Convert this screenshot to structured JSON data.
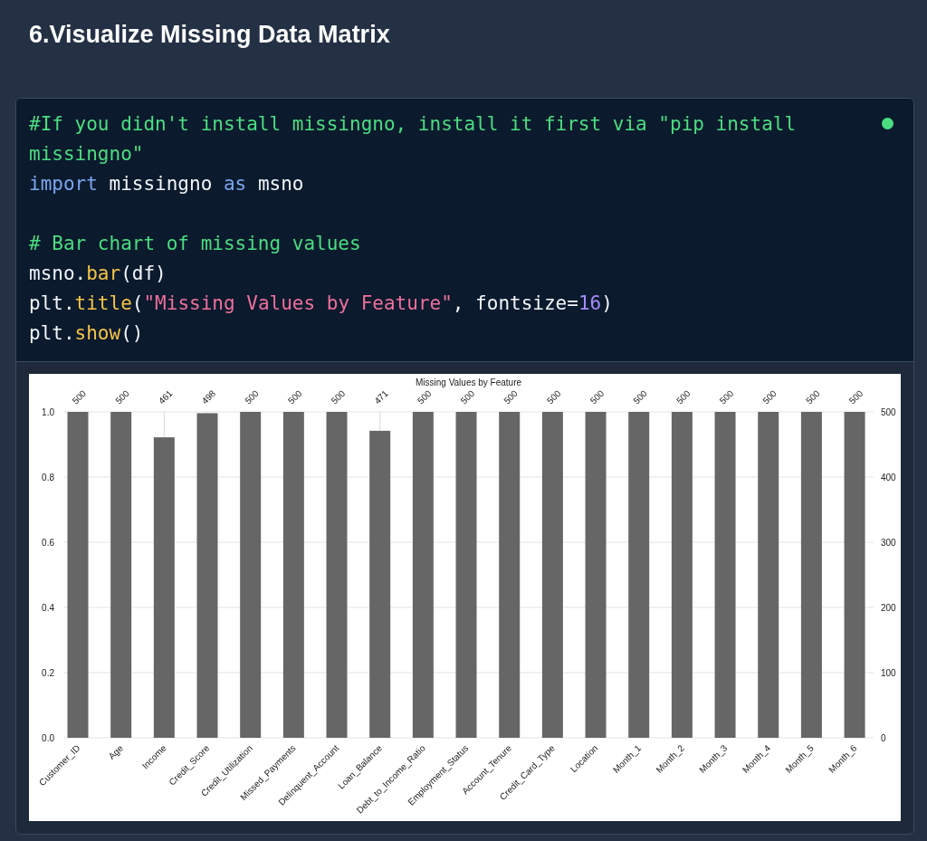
{
  "heading": "6.Visualize Missing Data Matrix",
  "code_cell": {
    "status_dot": true,
    "lines": [
      {
        "kind": "code",
        "tokens": [
          {
            "kind": "comment",
            "text": "#If you didn't install missingno, install it first via \"pip install missingno\""
          }
        ]
      },
      {
        "kind": "code",
        "tokens": [
          {
            "kind": "keyword",
            "text": "import"
          },
          {
            "kind": "plain",
            "text": " missingno "
          },
          {
            "kind": "keyword",
            "text": "as"
          },
          {
            "kind": "plain",
            "text": " msno"
          }
        ]
      },
      {
        "kind": "blank"
      },
      {
        "kind": "code",
        "tokens": [
          {
            "kind": "comment",
            "text": "# Bar chart of missing values"
          }
        ]
      },
      {
        "kind": "code",
        "tokens": [
          {
            "kind": "plain",
            "text": "msno."
          },
          {
            "kind": "func",
            "text": "bar"
          },
          {
            "kind": "plain",
            "text": "(df)"
          }
        ]
      },
      {
        "kind": "code",
        "tokens": [
          {
            "kind": "plain",
            "text": "plt."
          },
          {
            "kind": "func",
            "text": "title"
          },
          {
            "kind": "plain",
            "text": "("
          },
          {
            "kind": "string",
            "text": "\"Missing Values by Feature\""
          },
          {
            "kind": "plain",
            "text": ", fontsize="
          },
          {
            "kind": "number",
            "text": "16"
          },
          {
            "kind": "plain",
            "text": ")"
          }
        ]
      },
      {
        "kind": "code",
        "tokens": [
          {
            "kind": "plain",
            "text": "plt."
          },
          {
            "kind": "func",
            "text": "show"
          },
          {
            "kind": "plain",
            "text": "()"
          }
        ]
      }
    ]
  },
  "output": {
    "chart_data": {
      "type": "bar",
      "title": "Missing Values by Feature",
      "categories": [
        "Customer_ID",
        "Age",
        "Income",
        "Credit_Score",
        "Credit_Utilization",
        "Missed_Payments",
        "Delinquent_Account",
        "Loan_Balance",
        "Debt_to_Income_Ratio",
        "Employment_Status",
        "Account_Tenure",
        "Credit_Card_Type",
        "Location",
        "Month_1",
        "Month_2",
        "Month_3",
        "Month_4",
        "Month_5",
        "Month_6"
      ],
      "values": [
        500,
        500,
        461,
        498,
        500,
        500,
        500,
        471,
        500,
        500,
        500,
        500,
        500,
        500,
        500,
        500,
        500,
        500,
        500
      ],
      "data_labels": true,
      "grid": true,
      "ylim": [
        0,
        500
      ],
      "yticks": [
        0,
        100,
        200,
        300,
        400,
        500
      ],
      "annotations": [
        "0.0",
        "0.2",
        "0.4",
        "0.6",
        "0.8",
        "1.0"
      ]
    }
  }
}
